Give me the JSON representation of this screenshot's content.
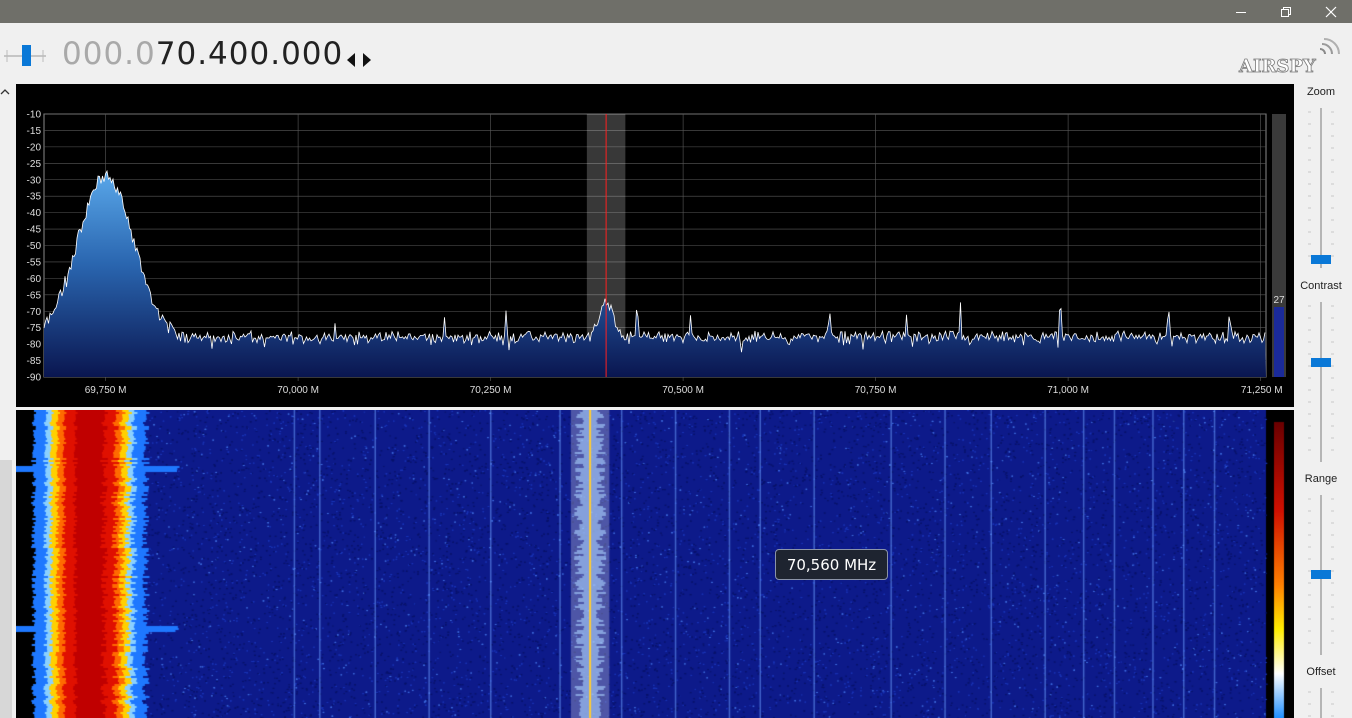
{
  "window": {
    "controls": [
      "minimize-icon",
      "restore-icon",
      "close-icon"
    ]
  },
  "toolbar": {
    "frequency_dim": "000.0",
    "frequency_main": "70.400.000",
    "logo_text": "AIRSPY"
  },
  "spectrum": {
    "db_labels": [
      "-10",
      "-15",
      "-20",
      "-25",
      "-30",
      "-35",
      "-40",
      "-45",
      "-50",
      "-55",
      "-60",
      "-65",
      "-70",
      "-75",
      "-80",
      "-85",
      "-90"
    ],
    "db_values": [
      -10,
      -15,
      -20,
      -25,
      -30,
      -35,
      -40,
      -45,
      -50,
      -55,
      -60,
      -65,
      -70,
      -75,
      -80,
      -85,
      -90
    ],
    "freq_labels": [
      "69,750 M",
      "70,000 M",
      "70,250 M",
      "70,500 M",
      "70,750 M",
      "71,000 M",
      "71,250 M"
    ],
    "freq_values_mhz": [
      69.75,
      70.0,
      70.25,
      70.5,
      70.75,
      71.0,
      71.25
    ],
    "center_freq_mhz": 70.4,
    "filter_width_mhz": 0.05,
    "level_value": "27",
    "colors": {
      "fill_top": "#4a90d9",
      "fill_bottom": "#0a1a5a",
      "trace": "#ffffff",
      "marker": "#ff2020"
    }
  },
  "waterfall": {
    "hover_tooltip": "70,560 MHz"
  },
  "side_panel": {
    "zoom_label": "Zoom",
    "contrast_label": "Contrast",
    "range_label": "Range",
    "offset_label": "Offset",
    "accent": "#0a78d7"
  }
}
